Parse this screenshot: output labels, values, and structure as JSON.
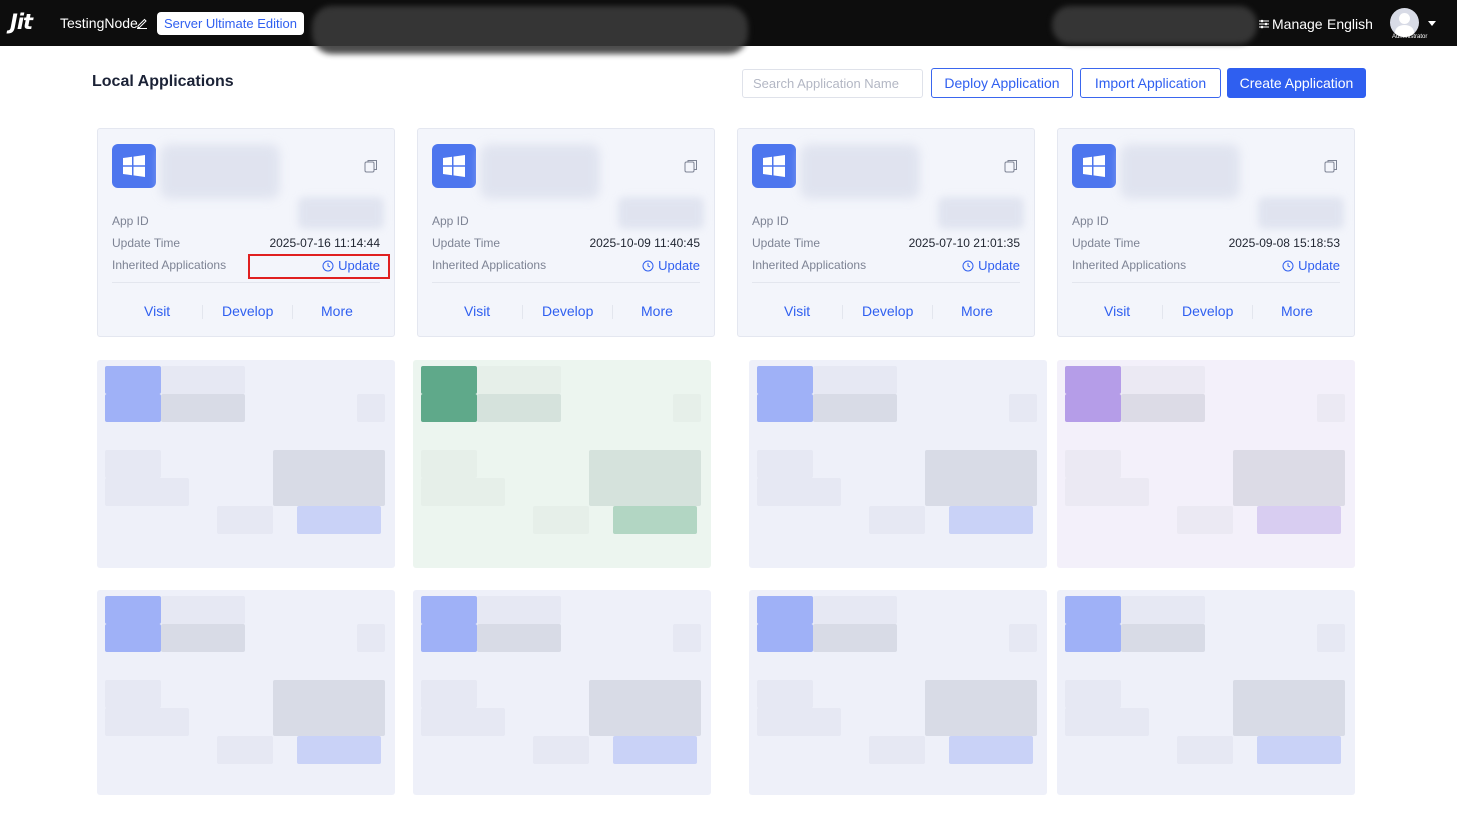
{
  "topbar": {
    "logo": "Jit",
    "node_name": "TestingNode",
    "edition": "Server Ultimate Edition",
    "manage": "Manage",
    "language": "English",
    "avatar_caption": "Administrator"
  },
  "header": {
    "title": "Local Applications",
    "search_placeholder": "Search Application Name",
    "deploy_label": "Deploy Application",
    "import_label": "Import Application",
    "create_label": "Create Application"
  },
  "labels": {
    "app_id": "App ID",
    "update_time": "Update Time",
    "inherited": "Inherited Applications",
    "update": "Update",
    "visit": "Visit",
    "develop": "Develop",
    "more": "More"
  },
  "cards": [
    {
      "update_time": "2025-07-16 11:14:44",
      "visit_label": "Visit"
    },
    {
      "update_time": "2025-10-09 11:40:45",
      "visit_label": "Visit"
    },
    {
      "update_time": "2025-07-10 21:01:35",
      "visit_label": "Visit"
    },
    {
      "update_time": "2025-09-08 15:18:53",
      "visit_label": "Visit"
    }
  ],
  "colors": {
    "accent": "#2f5ff0",
    "topbar": "#0d0d0d",
    "card_bg": "#f3f5fb",
    "highlight": "#e02020"
  }
}
